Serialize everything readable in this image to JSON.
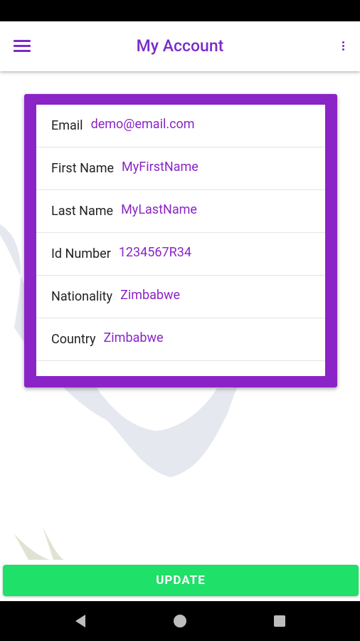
{
  "header": {
    "title": "My Account"
  },
  "account_fields": [
    {
      "label": "Email",
      "value": "demo@email.com"
    },
    {
      "label": "First Name",
      "value": "MyFirstName"
    },
    {
      "label": "Last Name",
      "value": "MyLastName"
    },
    {
      "label": "Id Number",
      "value": "1234567R34"
    },
    {
      "label": "Nationality",
      "value": "Zimbabwe"
    },
    {
      "label": "Country",
      "value": "Zimbabwe"
    }
  ],
  "actions": {
    "update_label": "UPDATE"
  },
  "icons": {
    "menu": "hamburger-menu-icon",
    "overflow": "more-vert-icon",
    "nav_back": "back-triangle-icon",
    "nav_home": "home-circle-icon",
    "nav_recent": "recent-apps-square-icon"
  },
  "colors": {
    "accent": "#7B2CC9",
    "card_border": "#8A24C7",
    "update_button": "#1FE068",
    "system_bars": "#000000"
  }
}
